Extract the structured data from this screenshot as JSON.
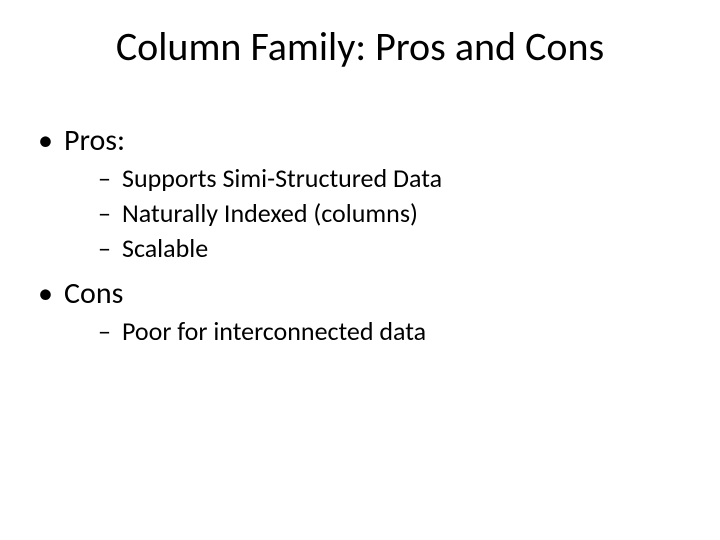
{
  "title": "Column Family: Pros and Cons",
  "bullets": [
    {
      "label": "Pros:",
      "sub": [
        "Supports Simi-Structured Data",
        "Naturally Indexed (columns)",
        "Scalable"
      ]
    },
    {
      "label": "Cons",
      "sub": [
        "Poor for interconnected data"
      ]
    }
  ]
}
